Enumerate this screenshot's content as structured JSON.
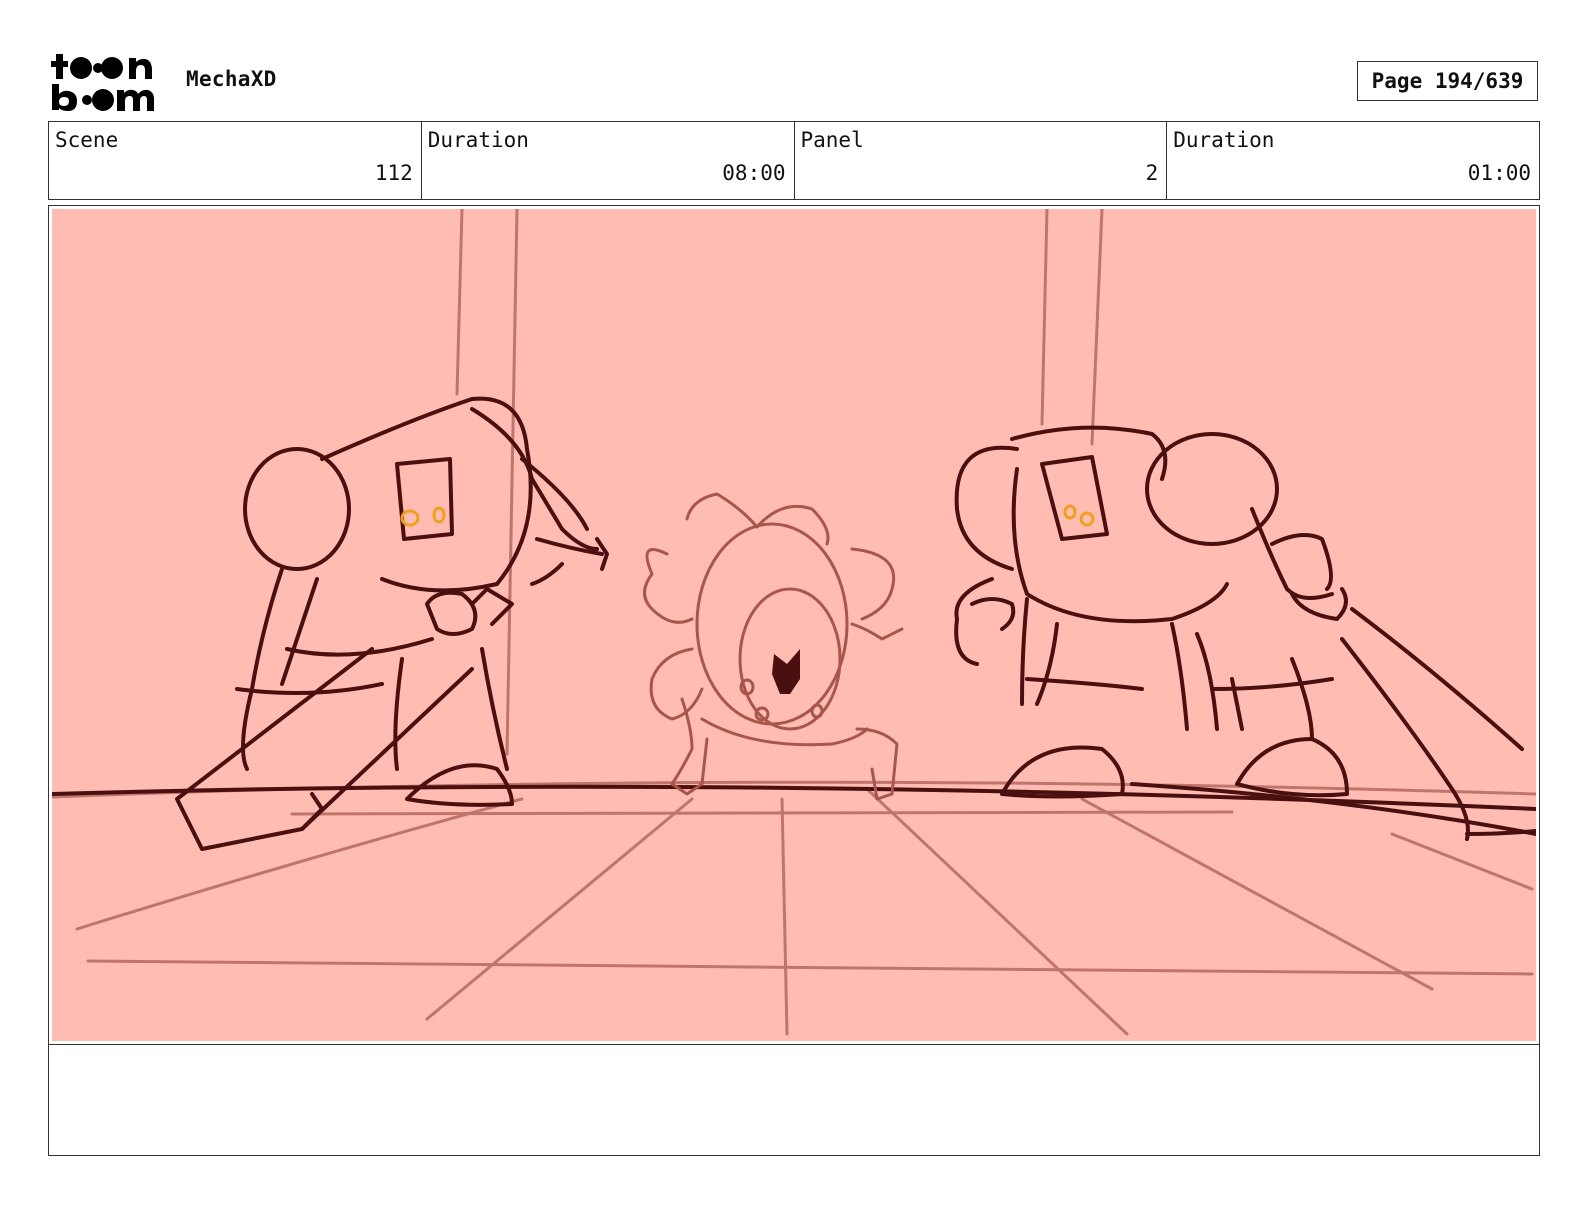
{
  "header": {
    "logo_text": "toon boom",
    "project_title": "MechaXD",
    "page_label": "Page 194/639"
  },
  "info": {
    "scene": {
      "label": "Scene",
      "value": "112"
    },
    "scene_duration": {
      "label": "Duration",
      "value": "08:00"
    },
    "panel": {
      "label": "Panel",
      "value": "2"
    },
    "panel_duration": {
      "label": "Duration",
      "value": "01:00"
    }
  },
  "colors": {
    "panel_background": "#ffbcb2",
    "line_dark": "#4a0f0f",
    "line_light": "#c0756c",
    "eye_accent": "#f0a020"
  },
  "notes": {
    "text": ""
  }
}
